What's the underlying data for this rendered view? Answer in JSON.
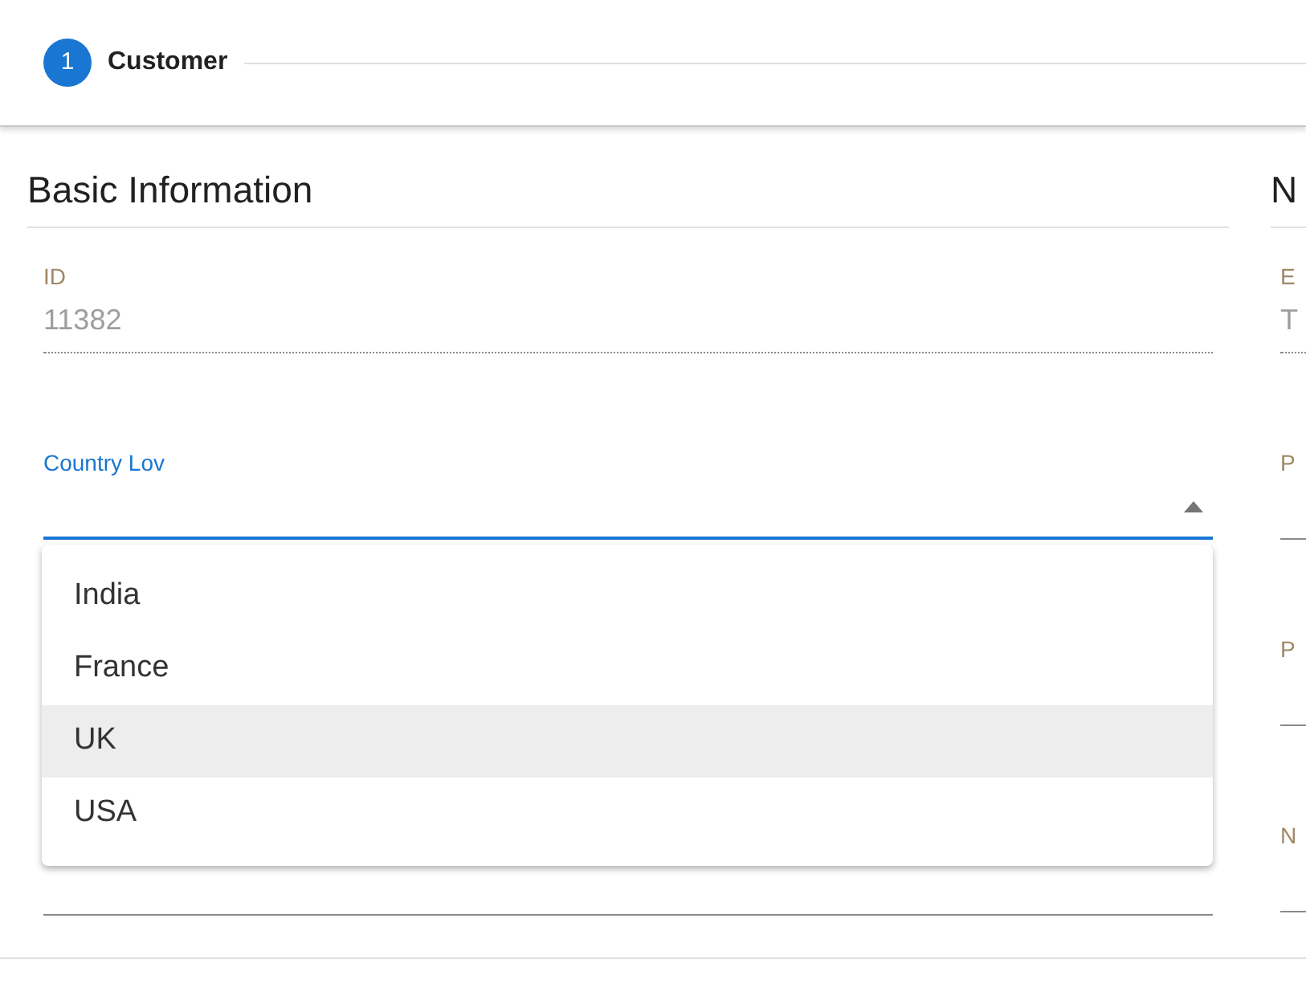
{
  "stepper": {
    "steps": [
      {
        "number": "1",
        "label": "Customer",
        "active": true
      }
    ]
  },
  "sections": [
    {
      "title": "Basic Information",
      "fields": [
        {
          "kind": "readonly",
          "label": "ID",
          "value": "11382"
        },
        {
          "kind": "select",
          "label": "Country Lov",
          "focused": true,
          "open": true,
          "options": [
            {
              "label": "India",
              "selected": false
            },
            {
              "label": "France",
              "selected": false
            },
            {
              "label": "UK",
              "selected": true
            },
            {
              "label": "USA",
              "selected": false
            }
          ]
        },
        {
          "kind": "text"
        }
      ]
    },
    {
      "title": "N",
      "fields": [
        {
          "kind": "readonly",
          "label": "E",
          "value": "T"
        },
        {
          "kind": "text",
          "label": "P"
        },
        {
          "kind": "text",
          "label": "P"
        },
        {
          "kind": "text",
          "label": "N"
        }
      ]
    }
  ]
}
